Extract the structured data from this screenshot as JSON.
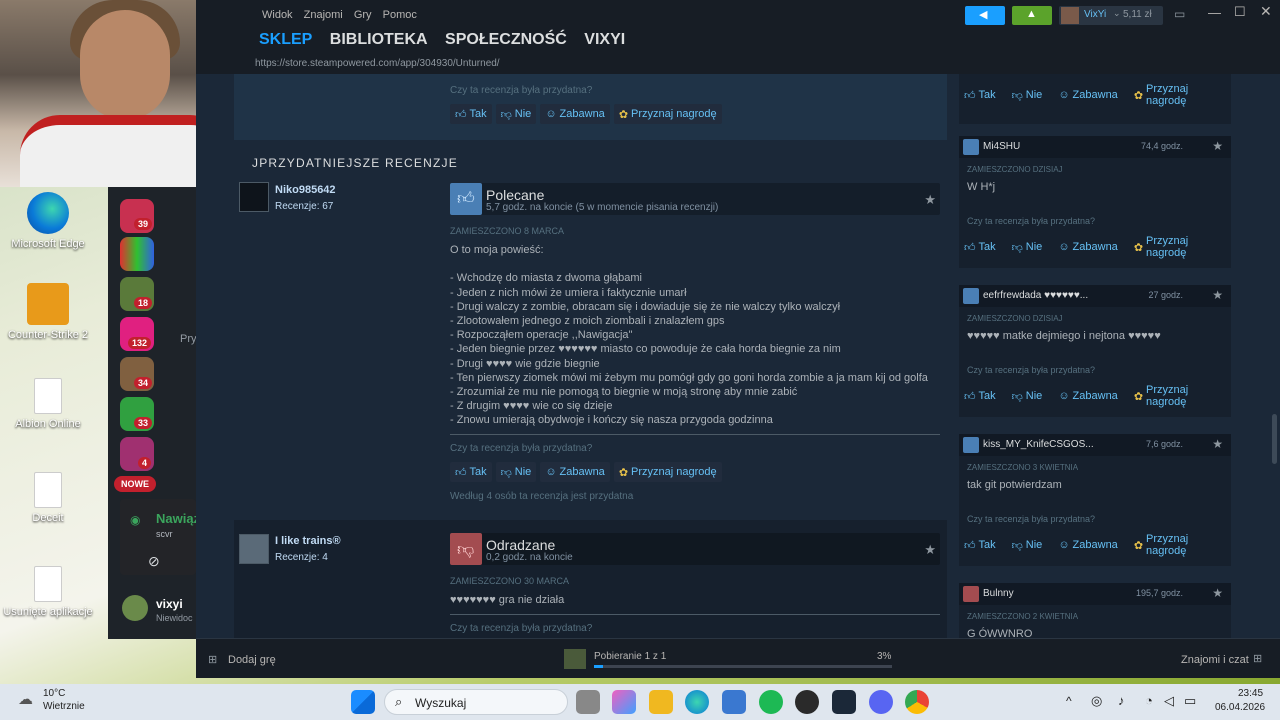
{
  "desktop": {
    "icons": [
      "Microsoft Edge",
      "Counter-Strike 2",
      "Albion Online",
      "Deceit",
      "Usunięte aplikacje"
    ]
  },
  "side_strip": {
    "badges": [
      "39",
      "18",
      "132",
      "34",
      "33",
      "4"
    ],
    "new_label": "NOWE",
    "connecting_title": "Nawiąz",
    "connecting_sub": "scvr",
    "user_name": "vixyi",
    "user_status": "Niewidoc",
    "section_label": "Pry"
  },
  "steam": {
    "menu": [
      "Widok",
      "Znajomi",
      "Gry",
      "Pomoc"
    ],
    "nav": [
      "SKLEP",
      "BIBLIOTEKA",
      "SPOŁECZNOŚĆ",
      "VIXYI"
    ],
    "url": "https://store.steampowered.com/app/304930/Unturned/",
    "account_name": "VixYi",
    "wallet": "5,11 zł",
    "section_title": "jprzydatniejsze recenzje",
    "top_question": "Czy ta recenzja była przydatna?",
    "vote": {
      "yes": "Tak",
      "no": "Nie",
      "funny": "Zabawna",
      "award": "Przyznaj nagrodę"
    },
    "reviews": [
      {
        "user": "Niko985642",
        "count": "Recenzje: 67",
        "verdict": "Polecane",
        "hours": "5,7 godz. na koncie (5 w momencie pisania recenzji)",
        "posted": "ZAMIESZCZONO 8 MARCA",
        "text": "O to moja powieść:\n\n- Wchodzę do miasta z dwoma głąbami\n- Jeden z nich mówi że umiera i faktycznie umarł\n- Drugi walczy z zombie, obracam się i dowiaduje się że nie walczy tylko walczył\n- Zlootowałem jednego z moich ziombali i znalazłem gps\n- Rozpocząłem operacje ,,Nawigacja\"\n- Jeden biegnie przez ♥♥♥♥♥♥ miasto co powoduje że cała horda biegnie za nim\n- Drugi ♥♥♥♥ wie gdzie biegnie\n- Ten pierwszy ziomek mówi mi żebym mu pomógł gdy go goni horda zombie a ja mam kij od golfa\n- Zrozumiał że mu nie pomogą to biegnie w moją stronę aby mnie zabić\n- Z drugim ♥♥♥♥ wie co się dzieje\n- Znowu umierają obydwoje i kończy się nasza przygoda godzinna",
        "question": "Czy ta recenzja była przydatna?",
        "helpful": "Według 4 osób ta recenzja jest przydatna"
      },
      {
        "user": "I like trains®",
        "count": "Recenzje: 4",
        "verdict": "Odradzane",
        "hours": "0,2 godz. na koncie",
        "posted": "ZAMIESZCZONO 30 MARCA",
        "text": "♥♥♥♥♥♥♥ gra nie działa",
        "question": "Czy ta recenzja była przydatna?"
      }
    ],
    "side_reviews": [
      {
        "user": "Mi4SHU",
        "hours": "74,4 godz.",
        "posted": "ZAMIESZCZONO DZISIAJ",
        "text": "W H*j",
        "question": "Czy ta recenzja była przydatna?",
        "positive": true
      },
      {
        "user": "eefrfrewdada ♥♥♥♥♥♥...",
        "hours": "27 godz.",
        "posted": "ZAMIESZCZONO DZISIAJ",
        "text": "♥♥♥♥♥ matke dejmiego i nejtona ♥♥♥♥♥",
        "question": "Czy ta recenzja była przydatna?",
        "positive": true
      },
      {
        "user": "kiss_MY_KnifeCSGOS...",
        "hours": "7,6 godz.",
        "posted": "ZAMIESZCZONO 3 KWIETNIA",
        "text": "tak git potwierdzam",
        "question": "Czy ta recenzja była przydatna?",
        "positive": true
      },
      {
        "user": "Bulnny",
        "hours": "195,7 godz.",
        "posted": "ZAMIESZCZONO 2 KWIETNIA",
        "text": "G ÓWWNRO",
        "positive": false
      }
    ],
    "footer": {
      "add_game": "Dodaj grę",
      "download": "Pobieranie 1 z 1",
      "percent": "3%",
      "progress": 0.03,
      "friends": "Znajomi i czat"
    }
  },
  "taskbar": {
    "weather_temp": "10°C",
    "weather_desc": "Wietrznie",
    "search": "Wyszukaj",
    "time": "23:45",
    "date": "06.04.2026"
  },
  "colors": {
    "accent": "#1a9fff",
    "link": "#66c0f4",
    "bg": "#1b2838",
    "award": "#e7c14a"
  }
}
